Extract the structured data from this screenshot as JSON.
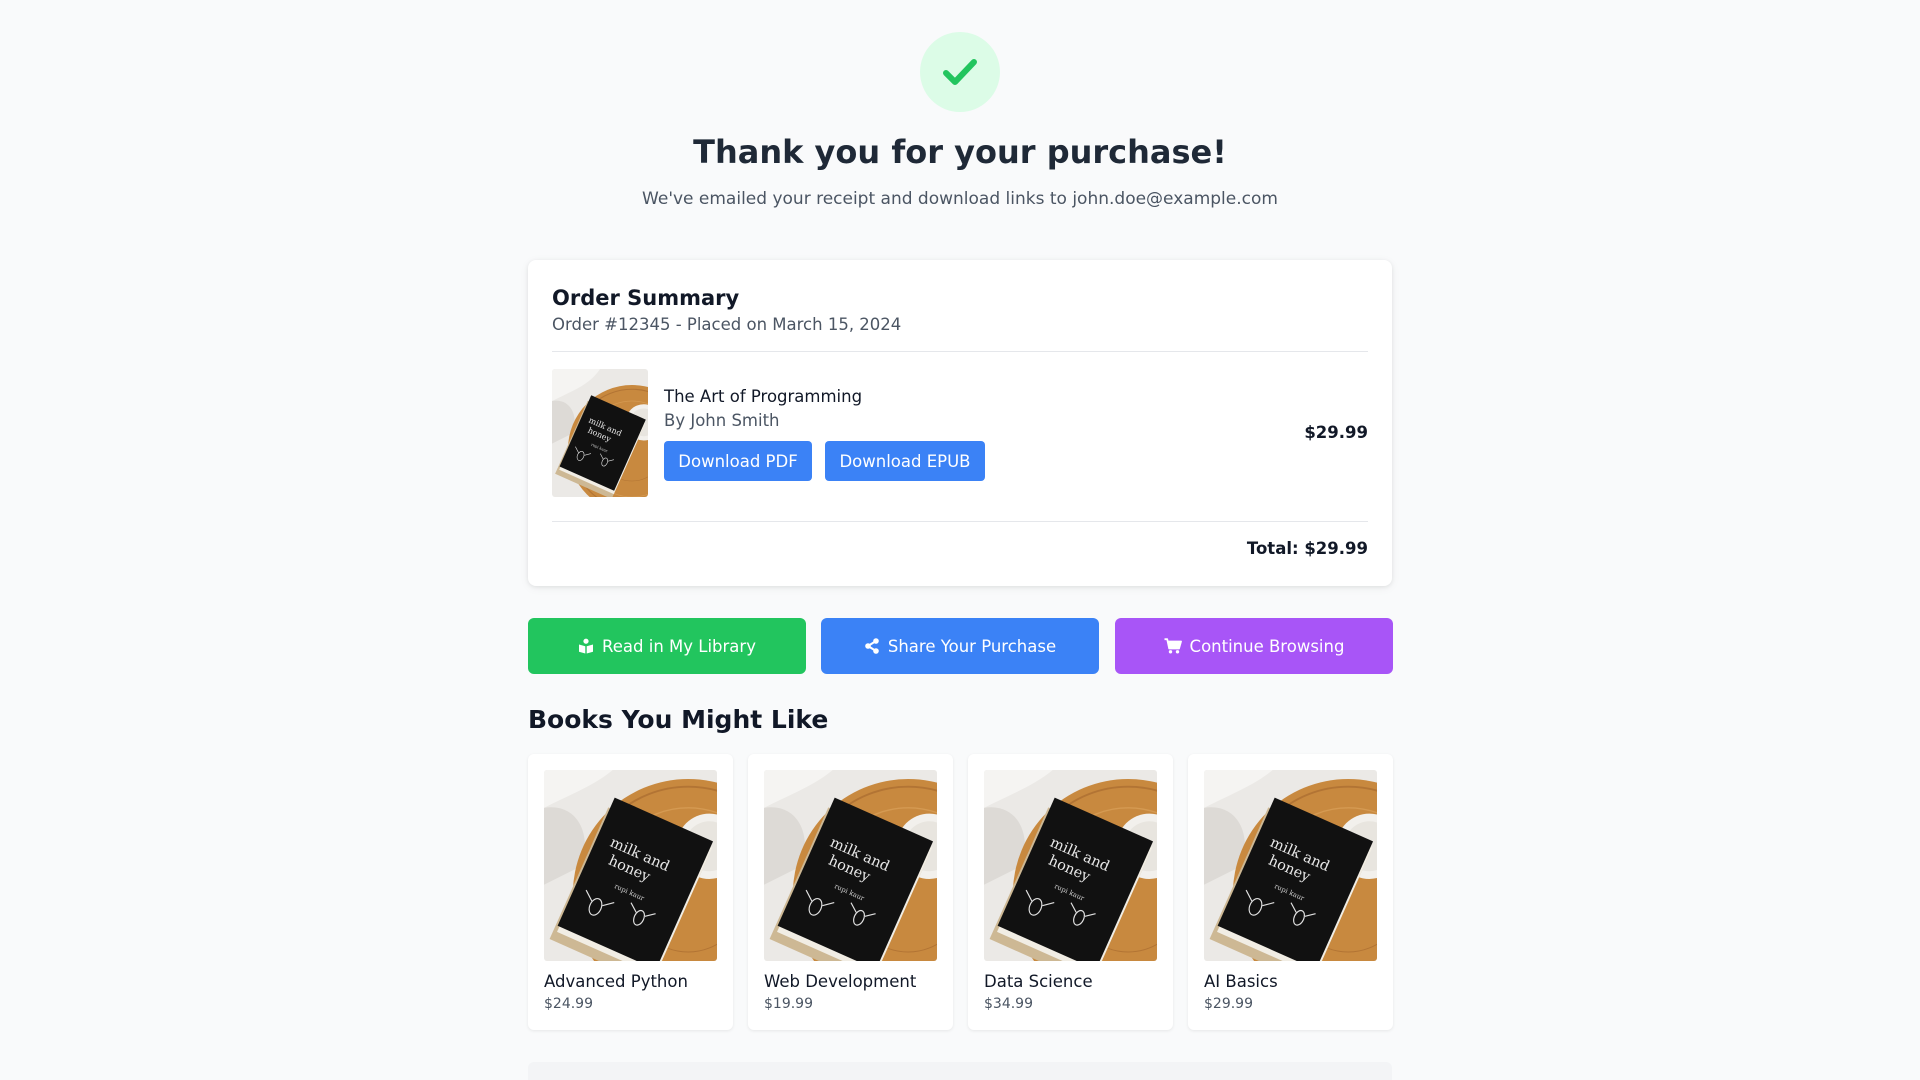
{
  "header": {
    "title": "Thank you for your purchase!",
    "subtitle": "We've emailed your receipt and download links to john.doe@example.com",
    "icon": "check-icon",
    "accent": "#22c55e"
  },
  "order": {
    "heading": "Order Summary",
    "meta": "Order #12345 - Placed on March 15, 2024",
    "item": {
      "title": "The Art of Programming",
      "author": "By John Smith",
      "price": "$29.99",
      "download_pdf": "Download PDF",
      "download_epub": "Download EPUB"
    },
    "total": "Total: $29.99"
  },
  "actions": {
    "library": {
      "label": "Read in My Library",
      "icon": "book-reader-icon",
      "color": "#22c55e"
    },
    "share": {
      "label": "Share Your Purchase",
      "icon": "share-icon",
      "color": "#3b82f6"
    },
    "browse": {
      "label": "Continue Browsing",
      "icon": "cart-icon",
      "color": "#a855f7"
    }
  },
  "recommendations": {
    "heading": "Books You Might Like",
    "items": [
      {
        "title": "Advanced Python",
        "price": "$24.99"
      },
      {
        "title": "Web Development",
        "price": "$19.99"
      },
      {
        "title": "Data Science",
        "price": "$34.99"
      },
      {
        "title": "AI Basics",
        "price": "$29.99"
      }
    ]
  },
  "cover_art": {
    "book_title_line1": "milk and",
    "book_title_line2": "honey",
    "book_author": "rupi kaur"
  }
}
